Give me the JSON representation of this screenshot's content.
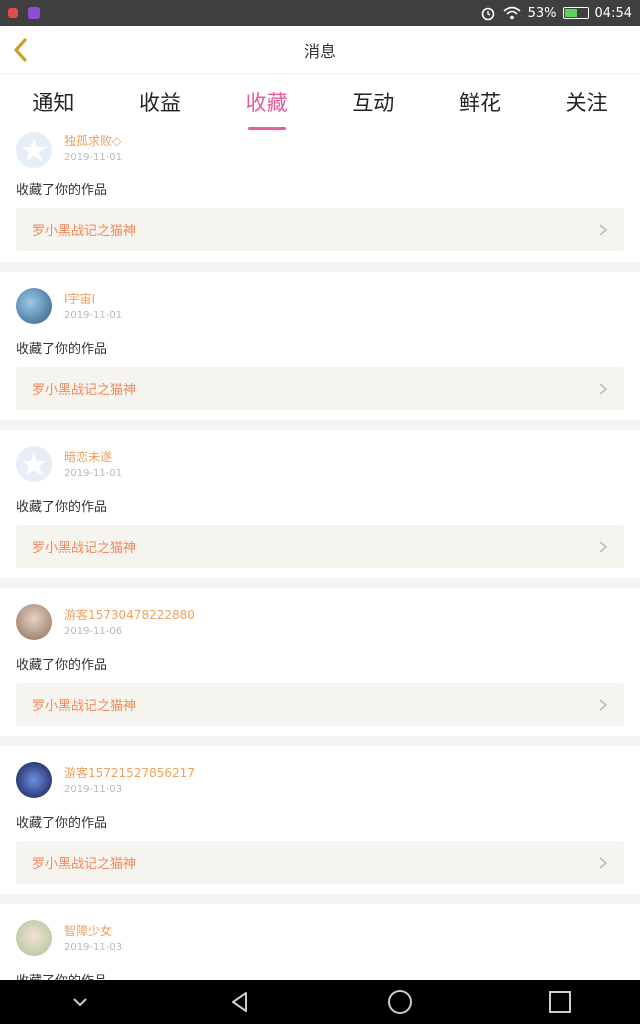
{
  "status_bar": {
    "battery": "53%",
    "time": "04:54",
    "battery_level": 0.53
  },
  "header": {
    "title": "消息"
  },
  "tabs": [
    {
      "label": "通知",
      "active": false
    },
    {
      "label": "收益",
      "active": false
    },
    {
      "label": "收藏",
      "active": true
    },
    {
      "label": "互动",
      "active": false
    },
    {
      "label": "鲜花",
      "active": false
    },
    {
      "label": "关注",
      "active": false
    }
  ],
  "items": [
    {
      "username": "独孤求败◇",
      "date": "2019-11-01",
      "action": "收藏了你的作品",
      "work_title": "罗小黑战记之猫神",
      "avatar": "default-avatar"
    },
    {
      "username": "I宇宙I",
      "date": "2019-11-01",
      "action": "收藏了你的作品",
      "work_title": "罗小黑战记之猫神",
      "avatar": "user-avatar"
    },
    {
      "username": "暗恋未遂",
      "date": "2019-11-01",
      "action": "收藏了你的作品",
      "work_title": "罗小黑战记之猫神",
      "avatar": "default-avatar"
    },
    {
      "username": "游客15730478222880",
      "date": "2019-11-06",
      "action": "收藏了你的作品",
      "work_title": "罗小黑战记之猫神",
      "avatar": "user-avatar"
    },
    {
      "username": "游客15721527856217",
      "date": "2019-11-03",
      "action": "收藏了你的作品",
      "work_title": "罗小黑战记之猫神",
      "avatar": "user-avatar"
    },
    {
      "username": "智障少女",
      "date": "2019-11-03",
      "action": "收藏了你的作品",
      "work_title": "",
      "avatar": "user-avatar"
    }
  ],
  "colors": {
    "accent": "#e65c9c",
    "username": "#f0a05a",
    "work_link": "#f08a5d",
    "back_arrow": "#c9a227"
  }
}
